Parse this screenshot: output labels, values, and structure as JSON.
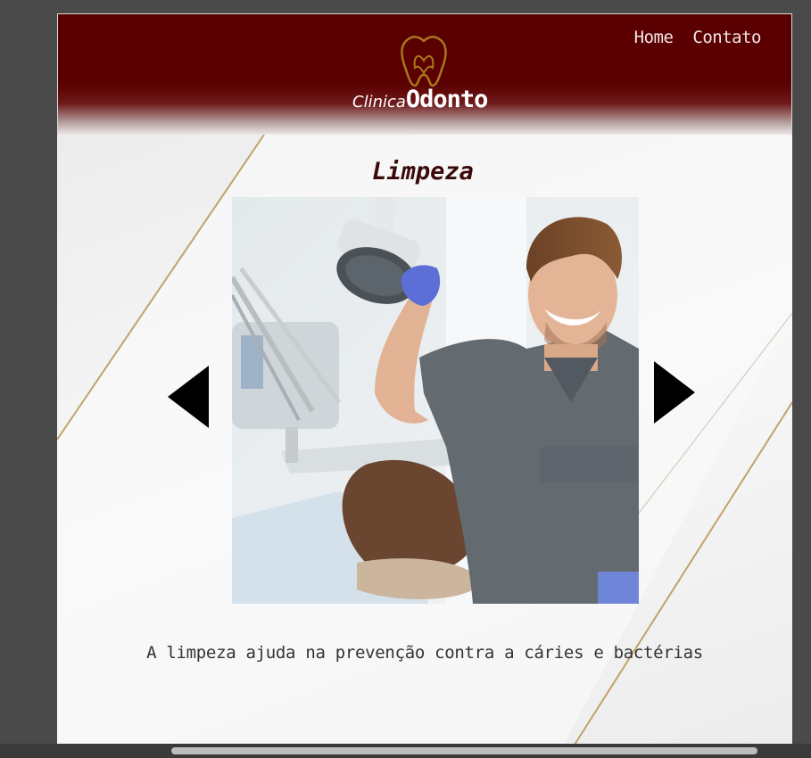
{
  "logo": {
    "small_text": "Clinica",
    "big_text": "Odonto",
    "tooth_color": "#a8761e"
  },
  "nav": {
    "home": "Home",
    "contact": "Contato"
  },
  "carousel": {
    "title": "Limpeza",
    "caption": "A limpeza ajuda na prevenção contra a cáries e bactérias",
    "prev_icon": "triangle-left-icon",
    "next_icon": "triangle-right-icon"
  },
  "colors": {
    "header": "#5a0000",
    "title": "#3a0a0a",
    "accent_gold": "#c3a169"
  }
}
